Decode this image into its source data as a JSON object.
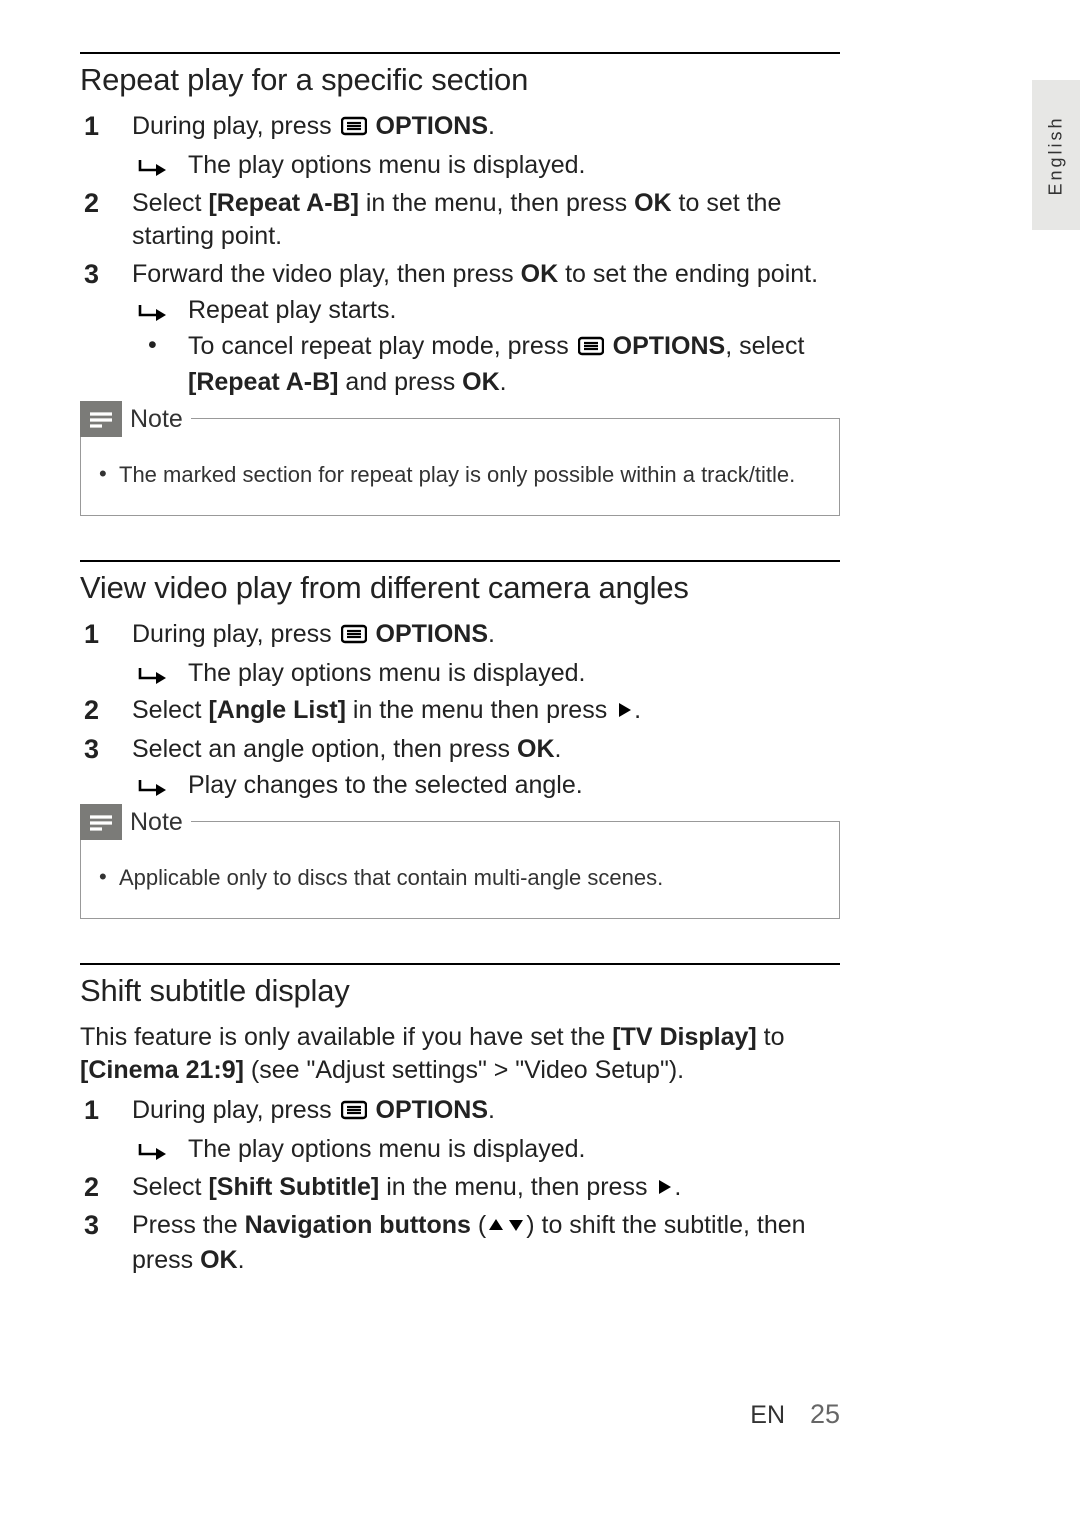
{
  "language_tab": "English",
  "icons": {
    "options": "options-icon"
  },
  "sections": {
    "repeat": {
      "title": "Repeat play for a specific section",
      "s1_a": "During play, press ",
      "s1_b": " OPTIONS",
      "s1_c": ".",
      "s1_sub": "The play options menu is displayed.",
      "s2_a": "Select ",
      "s2_b": "[Repeat A-B]",
      "s2_c": " in the menu, then press ",
      "s2_d": "OK",
      "s2_e": " to set the starting point.",
      "s3_a": "Forward the video play, then press ",
      "s3_b": "OK",
      "s3_c": " to set the ending point.",
      "s3_sub": "Repeat play starts.",
      "s3_bul_a": "To cancel repeat play mode, press ",
      "s3_bul_b": " OPTIONS",
      "s3_bul_c": ", select ",
      "s3_bul_d": "[Repeat A-B]",
      "s3_bul_e": " and press ",
      "s3_bul_f": "OK",
      "s3_bul_g": ".",
      "note_label": "Note",
      "note_item": "The marked section for repeat play is only possible within a track/title."
    },
    "angle": {
      "title": "View video play from different camera angles",
      "s1_a": "During play, press ",
      "s1_b": " OPTIONS",
      "s1_c": ".",
      "s1_sub": "The play options menu is displayed.",
      "s2_a": "Select ",
      "s2_b": "[Angle List]",
      "s2_c": " in the menu then press ",
      "s2_d": ".",
      "s3_a": "Select an angle option, then press ",
      "s3_b": "OK",
      "s3_c": ".",
      "s3_sub": "Play changes to the selected angle.",
      "note_label": "Note",
      "note_item": "Applicable only to discs that contain multi-angle scenes."
    },
    "shift": {
      "title": "Shift subtitle display",
      "intro_a": "This feature is only available if you have set the ",
      "intro_b": "[TV Display]",
      "intro_c": " to ",
      "intro_d": "[Cinema 21:9]",
      "intro_e": " (see \"Adjust settings\" > \"Video Setup\").",
      "s1_a": "During play, press ",
      "s1_b": " OPTIONS",
      "s1_c": ".",
      "s1_sub": "The play options menu is displayed.",
      "s2_a": "Select ",
      "s2_b": "[Shift Subtitle]",
      "s2_c": " in the menu, then press ",
      "s2_d": ".",
      "s3_a": "Press the ",
      "s3_b": "Navigation buttons",
      "s3_c": " (",
      "s3_d": ") to shift the subtitle, then press ",
      "s3_e": "OK",
      "s3_f": "."
    }
  },
  "footer": {
    "lang": "EN",
    "page": "25"
  }
}
